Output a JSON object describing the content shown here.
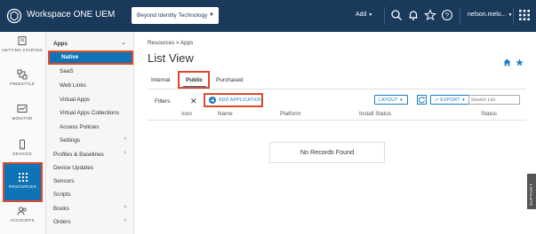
{
  "topbar": {
    "title": "Workspace ONE UEM",
    "org": "Beyond Identity Technology",
    "add_label": "Add",
    "user": "nelson.melo..."
  },
  "rail": [
    {
      "label": "GETTING STARTED",
      "icon": "book-icon"
    },
    {
      "label": "FREESTYLE",
      "icon": "freestyle-icon"
    },
    {
      "label": "MONITOR",
      "icon": "monitor-icon"
    },
    {
      "label": "DEVICES",
      "icon": "device-icon"
    },
    {
      "label": "RESOURCES",
      "icon": "grid-icon"
    },
    {
      "label": "ACCOUNTS",
      "icon": "accounts-icon"
    }
  ],
  "subnav": {
    "apps": "Apps",
    "native": "Native",
    "saas": "SaaS",
    "web_links": "Web Links",
    "virtual_apps": "Virtual Apps",
    "virtual_apps_collections": "Virtual Apps Collections",
    "access_policies": "Access Policies",
    "settings": "Settings",
    "profiles": "Profiles & Baselines",
    "device_updates": "Device Updates",
    "sensors": "Sensors",
    "scripts": "Scripts",
    "books": "Books",
    "orders": "Orders"
  },
  "main": {
    "breadcrumb": "Resources  >  Apps",
    "title": "List View",
    "tabs": [
      "Internal",
      "Public",
      "Purchased"
    ],
    "filters": "Filters",
    "add_application": "ADD APPLICATION",
    "layout": "LAYOUT",
    "export": "EXPORT",
    "search_placeholder": "Search List",
    "columns": [
      "Icon",
      "Name",
      "Platform",
      "Install Status",
      "Status"
    ],
    "empty": "No Records Found",
    "support": "SUPPORT"
  }
}
